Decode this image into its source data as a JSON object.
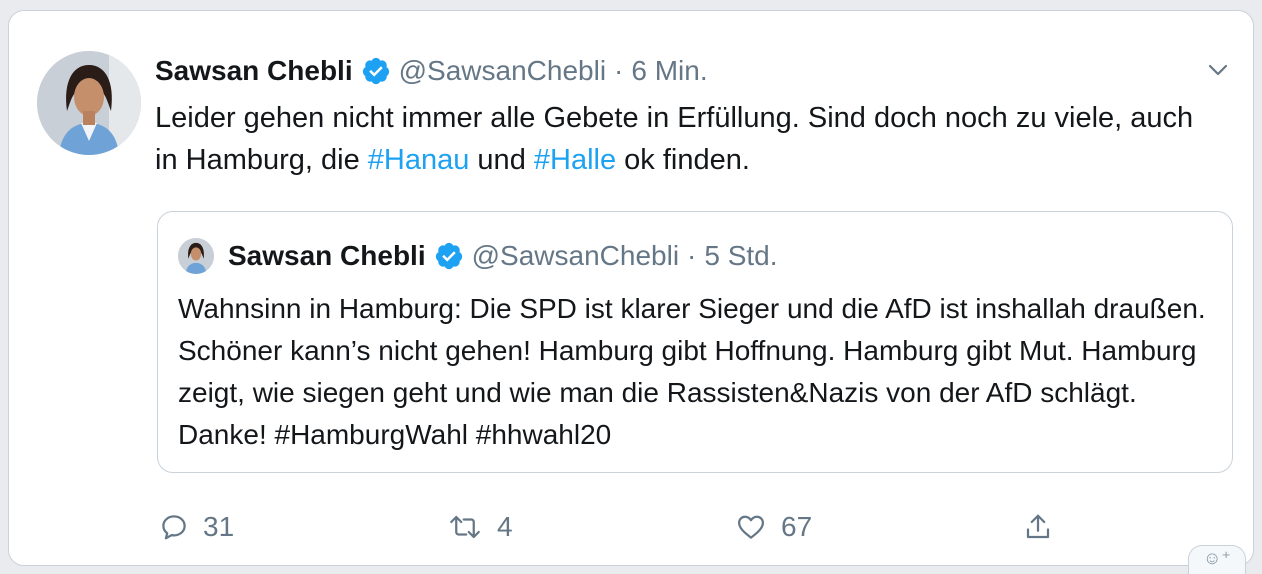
{
  "tweet": {
    "author_name": "Sawsan Chebli",
    "handle": "@SawsanChebli",
    "separator": "·",
    "time": "6 Min.",
    "text_part1": "Leider gehen nicht immer alle Gebete in Erfüllung. Sind doch noch zu viele, auch in Hamburg, die ",
    "hashtag1": "#Hanau",
    "text_part2": " und ",
    "hashtag2": "#Halle",
    "text_part3": " ok finden."
  },
  "quoted": {
    "author_name": "Sawsan Chebli",
    "handle": "@SawsanChebli",
    "separator": "·",
    "time": "5 Std.",
    "text": "Wahnsinn in Hamburg: Die SPD ist klarer Sieger und die AfD ist inshallah draußen. Schöner kann’s nicht gehen! Hamburg gibt Hoffnung. Hamburg gibt Mut. Hamburg zeigt, wie siegen geht und wie man die Rassisten&Nazis von der AfD schlägt. Danke! #HamburgWahl #hhwahl20"
  },
  "actions": {
    "reply_count": "31",
    "retweet_count": "4",
    "like_count": "67"
  },
  "colors": {
    "link": "#1da1f2",
    "muted": "#657786",
    "border": "#c9d2da"
  },
  "icons": [
    "verified-badge-icon",
    "chevron-down-icon",
    "reply-icon",
    "retweet-icon",
    "like-icon",
    "share-icon"
  ]
}
